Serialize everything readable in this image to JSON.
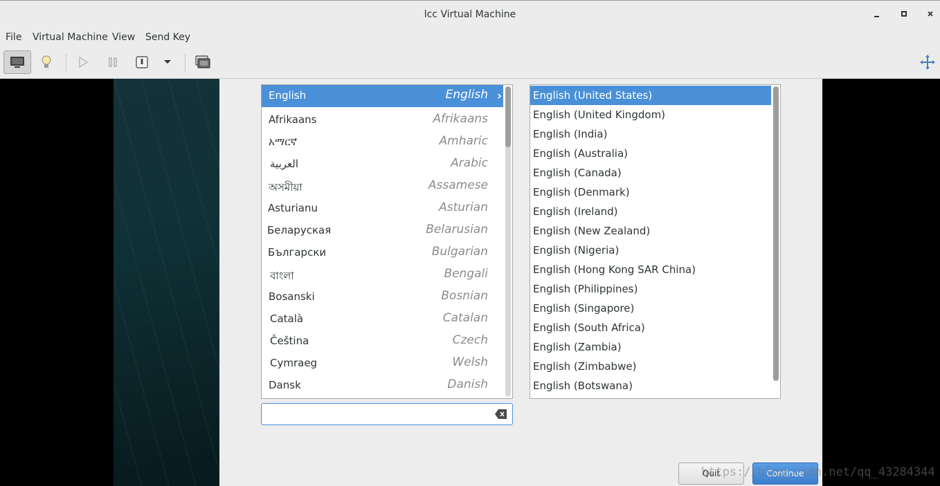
{
  "window": {
    "title": "lcc Virtual Machine"
  },
  "menu": [
    "File",
    "Virtual Machine",
    "View",
    "Send Key"
  ],
  "languages": [
    {
      "native": "English",
      "english": "English",
      "selected": true
    },
    {
      "native": "Afrikaans",
      "english": "Afrikaans"
    },
    {
      "native": "አማርኛ",
      "english": "Amharic"
    },
    {
      "native": "العربية",
      "english": "Arabic"
    },
    {
      "native": "অসমীয়া",
      "english": "Assamese"
    },
    {
      "native": "Asturianu",
      "english": "Asturian"
    },
    {
      "native": "Беларуская",
      "english": "Belarusian"
    },
    {
      "native": "Български",
      "english": "Bulgarian"
    },
    {
      "native": "বাংলা",
      "english": "Bengali"
    },
    {
      "native": "Bosanski",
      "english": "Bosnian"
    },
    {
      "native": "Català",
      "english": "Catalan"
    },
    {
      "native": "Čeština",
      "english": "Czech"
    },
    {
      "native": "Cymraeg",
      "english": "Welsh"
    },
    {
      "native": "Dansk",
      "english": "Danish"
    }
  ],
  "locales": [
    "English (United States)",
    "English (United Kingdom)",
    "English (India)",
    "English (Australia)",
    "English (Canada)",
    "English (Denmark)",
    "English (Ireland)",
    "English (New Zealand)",
    "English (Nigeria)",
    "English (Hong Kong SAR China)",
    "English (Philippines)",
    "English (Singapore)",
    "English (South Africa)",
    "English (Zambia)",
    "English (Zimbabwe)",
    "English (Botswana)"
  ],
  "search": {
    "value": ""
  },
  "buttons": {
    "quit": "Quit",
    "continue": "Continue"
  },
  "watermark": "https://blog.csdn.net/qq_43284344",
  "colors": {
    "selection": "#4a90d9",
    "chrome": "#ececec"
  }
}
